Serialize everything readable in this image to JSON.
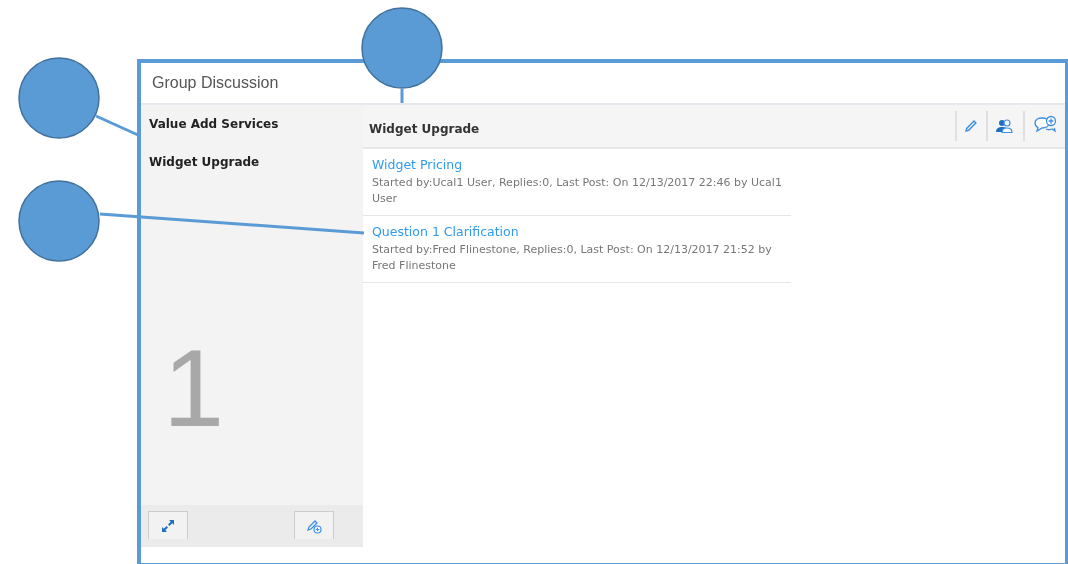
{
  "window": {
    "title": "Group Discussion"
  },
  "sidebar": {
    "items": [
      {
        "label": "Value Add Services"
      },
      {
        "label": "Widget Upgrade"
      }
    ],
    "step_number": "1"
  },
  "main": {
    "title": "Widget Upgrade",
    "topics": [
      {
        "title": "Widget Pricing",
        "meta": "Started by:Ucal1 User, Replies:0, Last Post: On 12/13/2017 22:46 by Ucal1 User"
      },
      {
        "title": "Question 1 Clarification",
        "meta": "Started by:Fred Flinestone, Replies:0, Last Post: On 12/13/2017 21:52 by Fred Flinestone"
      }
    ]
  }
}
